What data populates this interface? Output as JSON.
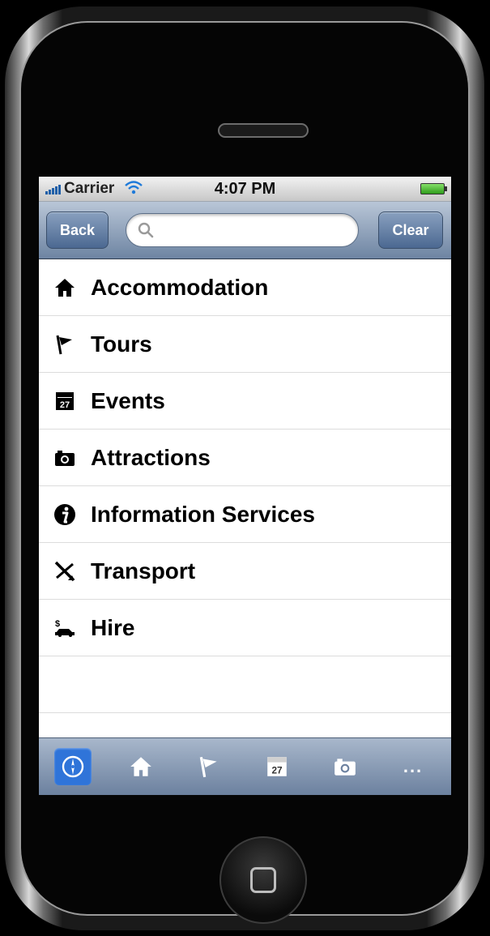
{
  "status_bar": {
    "carrier": "Carrier",
    "time": "4:07 PM"
  },
  "nav_bar": {
    "back_label": "Back",
    "clear_label": "Clear",
    "search_value": "",
    "search_placeholder": ""
  },
  "list_items": [
    {
      "label": "Accommodation",
      "icon": "house-icon"
    },
    {
      "label": "Tours",
      "icon": "flag-icon"
    },
    {
      "label": "Events",
      "icon": "calendar-icon"
    },
    {
      "label": "Attractions",
      "icon": "camera-icon"
    },
    {
      "label": "Information Services",
      "icon": "info-icon"
    },
    {
      "label": "Transport",
      "icon": "plane-icon"
    },
    {
      "label": "Hire",
      "icon": "car-hire-icon"
    }
  ],
  "calendar_day": "27",
  "tab_bar": {
    "tabs": [
      {
        "icon": "compass-icon",
        "active": true
      },
      {
        "icon": "house-icon"
      },
      {
        "icon": "flag-icon"
      },
      {
        "icon": "calendar-icon"
      },
      {
        "icon": "camera-icon"
      },
      {
        "icon": "more-icon"
      }
    ],
    "more_label": "..."
  },
  "colors": {
    "accent": "#2f74d9",
    "navbar": "#6d84a2"
  }
}
